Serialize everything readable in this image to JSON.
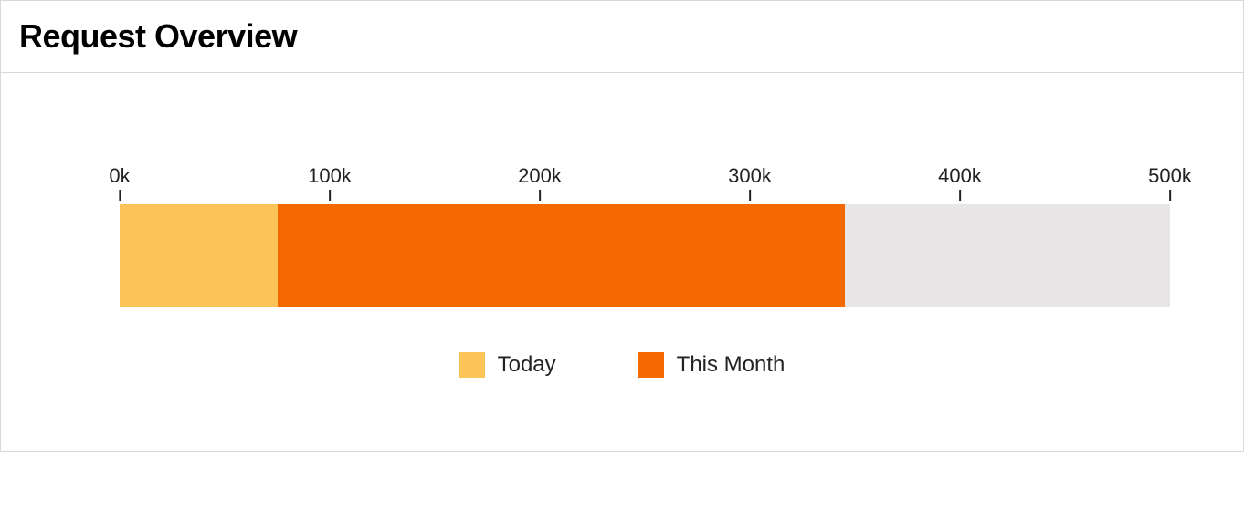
{
  "title": "Request Overview",
  "chart_data": {
    "type": "bar",
    "orientation": "horizontal-stacked",
    "xlabel": "",
    "ylabel": "",
    "xlim": [
      0,
      500000
    ],
    "ticks": [
      {
        "value": 0,
        "label": "0k"
      },
      {
        "value": 100000,
        "label": "100k"
      },
      {
        "value": 200000,
        "label": "200k"
      },
      {
        "value": 300000,
        "label": "300k"
      },
      {
        "value": 400000,
        "label": "400k"
      },
      {
        "value": 500000,
        "label": "500k"
      }
    ],
    "series": [
      {
        "name": "Today",
        "value": 75000,
        "color": "#fcc358"
      },
      {
        "name": "This Month",
        "value": 270000,
        "color": "#f56a00"
      }
    ],
    "track_color": "#e8e6e6",
    "total_capacity": 500000
  },
  "legend": [
    {
      "label": "Today",
      "color": "#fcc358"
    },
    {
      "label": "This Month",
      "color": "#f56a00"
    }
  ]
}
